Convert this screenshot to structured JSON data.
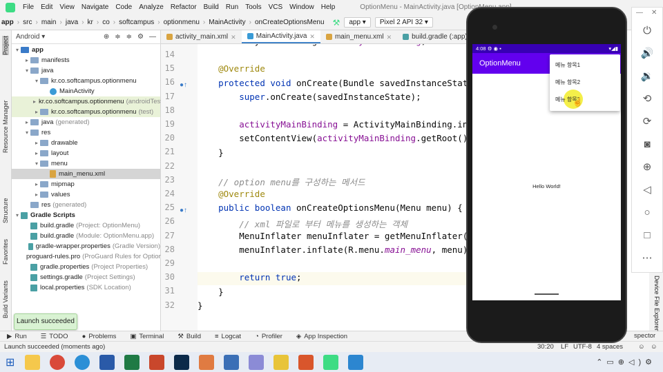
{
  "menubar": {
    "items": [
      "File",
      "Edit",
      "View",
      "Navigate",
      "Code",
      "Analyze",
      "Refactor",
      "Build",
      "Run",
      "Tools",
      "VCS",
      "Window",
      "Help"
    ],
    "window_title": "OptionMenu - MainActivity.java [OptionMenu.app]"
  },
  "navbar": {
    "crumbs": [
      "app",
      "src",
      "main",
      "java",
      "kr",
      "co",
      "softcampus",
      "optionmenu",
      "MainActivity",
      "onCreateOptionsMenu"
    ],
    "run_config": "app",
    "device": "Pixel 2 API 32"
  },
  "left_strip": {
    "labels": [
      "Project",
      "Resource Manager",
      "Structure",
      "Favorites",
      "Build Variants"
    ]
  },
  "project_pane": {
    "view_mode": "Android",
    "tree": [
      {
        "label": "app",
        "extra": "",
        "depth": 0,
        "arrow": "▾",
        "kind": "mod"
      },
      {
        "label": "manifests",
        "extra": "",
        "depth": 1,
        "arrow": "▸",
        "kind": "fold"
      },
      {
        "label": "java",
        "extra": "",
        "depth": 1,
        "arrow": "▾",
        "kind": "fold"
      },
      {
        "label": "kr.co.softcampus.optionmenu",
        "extra": "",
        "depth": 2,
        "arrow": "▾",
        "kind": "fold"
      },
      {
        "label": "MainActivity",
        "extra": "",
        "depth": 3,
        "arrow": "",
        "kind": "cls"
      },
      {
        "label": "kr.co.softcampus.optionmenu",
        "extra": "(androidTest)",
        "depth": 2,
        "arrow": "▸",
        "kind": "fold",
        "hl": true
      },
      {
        "label": "kr.co.softcampus.optionmenu",
        "extra": "(test)",
        "depth": 2,
        "arrow": "▸",
        "kind": "fold",
        "hl": true
      },
      {
        "label": "java",
        "extra": "(generated)",
        "depth": 1,
        "arrow": "▸",
        "kind": "fold"
      },
      {
        "label": "res",
        "extra": "",
        "depth": 1,
        "arrow": "▾",
        "kind": "fold"
      },
      {
        "label": "drawable",
        "extra": "",
        "depth": 2,
        "arrow": "▸",
        "kind": "fold"
      },
      {
        "label": "layout",
        "extra": "",
        "depth": 2,
        "arrow": "▸",
        "kind": "fold"
      },
      {
        "label": "menu",
        "extra": "",
        "depth": 2,
        "arrow": "▾",
        "kind": "fold"
      },
      {
        "label": "main_menu.xml",
        "extra": "",
        "depth": 3,
        "arrow": "",
        "kind": "file",
        "sel": true
      },
      {
        "label": "mipmap",
        "extra": "",
        "depth": 2,
        "arrow": "▸",
        "kind": "fold"
      },
      {
        "label": "values",
        "extra": "",
        "depth": 2,
        "arrow": "▸",
        "kind": "fold"
      },
      {
        "label": "res",
        "extra": "(generated)",
        "depth": 1,
        "arrow": "",
        "kind": "fold"
      },
      {
        "label": "Gradle Scripts",
        "extra": "",
        "depth": 0,
        "arrow": "▾",
        "kind": "grad"
      },
      {
        "label": "build.gradle",
        "extra": "(Project: OptionMenu)",
        "depth": 1,
        "arrow": "",
        "kind": "grad"
      },
      {
        "label": "build.gradle",
        "extra": "(Module: OptionMenu.app)",
        "depth": 1,
        "arrow": "",
        "kind": "grad"
      },
      {
        "label": "gradle-wrapper.properties",
        "extra": "(Gradle Version)",
        "depth": 1,
        "arrow": "",
        "kind": "grad"
      },
      {
        "label": "proguard-rules.pro",
        "extra": "(ProGuard Rules for OptionMenu)",
        "depth": 1,
        "arrow": "",
        "kind": "grad"
      },
      {
        "label": "gradle.properties",
        "extra": "(Project Properties)",
        "depth": 1,
        "arrow": "",
        "kind": "grad"
      },
      {
        "label": "settings.gradle",
        "extra": "(Project Settings)",
        "depth": 1,
        "arrow": "",
        "kind": "grad"
      },
      {
        "label": "local.properties",
        "extra": "(SDK Location)",
        "depth": 1,
        "arrow": "",
        "kind": "grad"
      }
    ]
  },
  "toast": "Launch succeeded",
  "editor_tabs": [
    {
      "label": "activity_main.xml",
      "active": false,
      "color": "#d9a441"
    },
    {
      "label": "MainActivity.java",
      "active": true,
      "color": "#3a9bd6"
    },
    {
      "label": "main_menu.xml",
      "active": false,
      "color": "#d9a441"
    },
    {
      "label": "build.gradle (:app)",
      "active": false,
      "color": "#4aa0a4"
    }
  ],
  "line_numbers": [
    "14",
    "15",
    "16",
    "17",
    "18",
    "19",
    "20",
    "21",
    "22",
    "23",
    "24",
    "25",
    "26",
    "27",
    "28",
    "29",
    "30",
    "31",
    "32"
  ],
  "code_lines": [
    [
      {
        "t": "    ActivityMainBinding ",
        "c": ""
      },
      {
        "t": "activityMainBinding",
        "c": "fld"
      },
      {
        "t": ";",
        "c": ""
      }
    ],
    [],
    [
      {
        "t": "    ",
        "c": ""
      },
      {
        "t": "@Override",
        "c": "an"
      }
    ],
    [
      {
        "t": "    ",
        "c": ""
      },
      {
        "t": "protected void ",
        "c": "kw"
      },
      {
        "t": "onCreate(Bundle savedInstanceState) {",
        "c": ""
      }
    ],
    [
      {
        "t": "        ",
        "c": ""
      },
      {
        "t": "super",
        "c": "kw"
      },
      {
        "t": ".onCreate(savedInstanceState);",
        "c": ""
      }
    ],
    [],
    [
      {
        "t": "        ",
        "c": ""
      },
      {
        "t": "activityMainBinding",
        "c": "fld"
      },
      {
        "t": " = ActivityMainBinding.inflate(getLayoutInflater());",
        "c": ""
      }
    ],
    [
      {
        "t": "        setContentView(",
        "c": ""
      },
      {
        "t": "activityMainBinding",
        "c": "fld"
      },
      {
        "t": ".getRoot());",
        "c": ""
      }
    ],
    [
      {
        "t": "    }",
        "c": ""
      }
    ],
    [],
    [
      {
        "t": "    ",
        "c": ""
      },
      {
        "t": "// option menu를 구성하는 메서드",
        "c": "cm"
      }
    ],
    [
      {
        "t": "    ",
        "c": ""
      },
      {
        "t": "@Override",
        "c": "an"
      }
    ],
    [
      {
        "t": "    ",
        "c": ""
      },
      {
        "t": "public boolean ",
        "c": "kw"
      },
      {
        "t": "onCreateOptionsMenu(Menu menu) {",
        "c": ""
      }
    ],
    [
      {
        "t": "        ",
        "c": ""
      },
      {
        "t": "// xml 파일로 부터 메뉴를 생성하는 객체",
        "c": "cm"
      }
    ],
    [
      {
        "t": "        MenuInflater menuInflater = getMenuInflater();",
        "c": ""
      }
    ],
    [
      {
        "t": "        menuInflater.inflate(R.menu.",
        "c": ""
      },
      {
        "t": "main_menu",
        "c": "fld it"
      },
      {
        "t": ", menu);",
        "c": ""
      }
    ],
    [],
    [
      {
        "t": "        ",
        "c": ""
      },
      {
        "t": "return true",
        "c": "kw"
      },
      {
        "t": ";",
        "c": ""
      }
    ],
    [
      {
        "t": "    }",
        "c": ""
      }
    ],
    [
      {
        "t": "}",
        "c": ""
      }
    ]
  ],
  "bottom_tabs": [
    "Run",
    "TODO",
    "Problems",
    "Terminal",
    "Build",
    "Logcat",
    "Profiler",
    "App Inspection"
  ],
  "right_tool_labels": [
    "Device File Explorer"
  ],
  "status": {
    "message": "Launch succeeded (moments ago)",
    "position": "30:20",
    "line_sep": "LF",
    "encoding": "UTF-8",
    "indent": "4 spaces",
    "layout_inspector": "spector"
  },
  "emulator": {
    "time": "4:08",
    "app_title": "OptionMenu",
    "menu_items": [
      "메뉴 항목1",
      "메뉴 항목2",
      "메뉴 항목3"
    ],
    "body_text": "Hello World!"
  },
  "emulator_toolbar": [
    "power-icon",
    "volume-up-icon",
    "volume-down-icon",
    "rotate-left-icon",
    "rotate-right-icon",
    "camera-icon",
    "zoom-icon",
    "back-icon",
    "home-icon",
    "overview-icon",
    "more-icon"
  ],
  "taskbar_apps": [
    "start-icon",
    "explorer-icon",
    "chrome-icon",
    "edge-icon",
    "word-icon",
    "excel-icon",
    "powerpoint-icon",
    "photoshop-icon",
    "paint-icon",
    "calculator-icon",
    "snipping-icon",
    "sticky-icon",
    "office-icon",
    "android-studio-icon",
    "emulator-icon"
  ]
}
